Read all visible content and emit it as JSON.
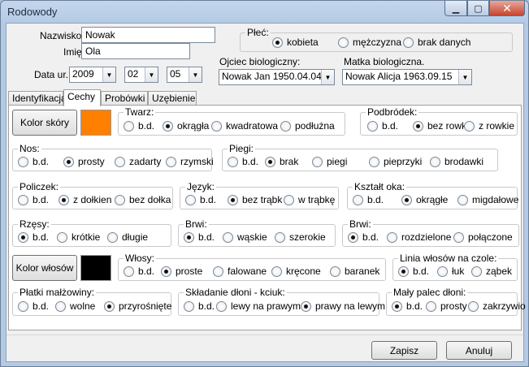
{
  "window": {
    "title": "Rodowody",
    "min": "▁",
    "max": "▢",
    "close": "✕"
  },
  "form": {
    "nazwisko_label": "Nazwisko",
    "nazwisko_value": "Nowak",
    "imie_label": "Imię",
    "imie_value": "Ola",
    "data_label": "Data ur.",
    "year": "2009",
    "month": "02",
    "day": "05",
    "plec": {
      "title": "Płeć:",
      "options": [
        "kobieta",
        "mężczyzna",
        "brak danych"
      ],
      "selected": 0
    },
    "ojciec_label": "Ojciec biologiczny:",
    "ojciec_value": "Nowak Jan 1950.04.04",
    "matka_label": "Matka biologiczna.",
    "matka_value": "Nowak Alicja 1963.09.15"
  },
  "tabs": [
    {
      "label": "Identyfikacja"
    },
    {
      "label": "Cechy"
    },
    {
      "label": "Probówki"
    },
    {
      "label": "Uzębienie"
    }
  ],
  "cechy": {
    "kolor_skory_label": "Kolor skóry",
    "skin_color": "#ff8000",
    "kolor_wlosow_label": "Kolor włosów",
    "hair_color": "#000000",
    "twarz": {
      "title": "Twarz:",
      "options": [
        "b.d.",
        "okrągła",
        "kwadratowa",
        "podłużna"
      ]
    },
    "podbrodek": {
      "title": "Podbródek:",
      "options": [
        "b.d.",
        "bez rowk",
        "z rowkie"
      ]
    },
    "nos": {
      "title": "Nos:",
      "options": [
        "b.d.",
        "prosty",
        "zadarty",
        "rzymski"
      ]
    },
    "piegi": {
      "title": "Piegi:",
      "options": [
        "b.d.",
        "brak",
        "piegi",
        "pieprzyki",
        "brodawki"
      ]
    },
    "policzek": {
      "title": "Policzek:",
      "options": [
        "b.d.",
        "z dołkien",
        "bez dołka"
      ]
    },
    "jezyk": {
      "title": "Język:",
      "options": [
        "b.d.",
        "bez trąbk",
        "w trąbkę"
      ]
    },
    "ksztalt_oka": {
      "title": "Kształt oka:",
      "options": [
        "b.d.",
        "okrągłe",
        "migdałowe"
      ]
    },
    "rzesy": {
      "title": "Rzęsy:",
      "options": [
        "b.d.",
        "krótkie",
        "długie"
      ]
    },
    "brwi1": {
      "title": "Brwi:",
      "options": [
        "b.d.",
        "wąskie",
        "szerokie"
      ]
    },
    "brwi2": {
      "title": "Brwi:",
      "options": [
        "b.d.",
        "rozdzielone",
        "połączone"
      ]
    },
    "wlosy": {
      "title": "Włosy:",
      "options": [
        "b.d.",
        "proste",
        "falowane",
        "kręcone",
        "baranek"
      ]
    },
    "linia": {
      "title": "Linia włosów na czole:",
      "options": [
        "b.d.",
        "łuk",
        "ząbek"
      ]
    },
    "platki": {
      "title": "Płatki małżowiny:",
      "options": [
        "b.d.",
        "wolne",
        "przyrośnięte"
      ]
    },
    "skladanie": {
      "title": "Składanie dłoni - kciuk:",
      "options": [
        "b.d.",
        "lewy na prawym",
        "prawy na lewym"
      ]
    },
    "maly_palec": {
      "title": "Mały palec dłoni:",
      "options": [
        "b.d.",
        "prosty",
        "zakrzywio"
      ]
    }
  },
  "buttons": {
    "save": "Zapisz",
    "cancel": "Anuluj"
  }
}
